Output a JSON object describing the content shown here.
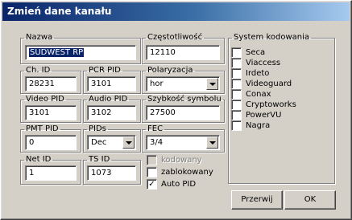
{
  "window": {
    "title": "Zmień dane kanału"
  },
  "fields": {
    "nazwa": {
      "label": "Nazwa",
      "value": "SUDWEST RP"
    },
    "czestotliwosc": {
      "label": "Częstotliwość",
      "value": "12110"
    },
    "ch_id": {
      "label": "Ch. ID",
      "value": "28231"
    },
    "pcr_pid": {
      "label": "PCR PID",
      "value": "3101"
    },
    "polaryzacja": {
      "label": "Polaryzacja",
      "value": "hor"
    },
    "video_pid": {
      "label": "Video PID",
      "value": "3101"
    },
    "audio_pid": {
      "label": "Audio PID",
      "value": "3102"
    },
    "szybkosc_symbolu": {
      "label": "Szybkość symbolu",
      "value": "27500"
    },
    "pmt_pid": {
      "label": "PMT PID",
      "value": "0"
    },
    "pids": {
      "label": "PIDs",
      "value": "Dec"
    },
    "fec": {
      "label": "FEC",
      "value": "3/4"
    },
    "net_id": {
      "label": "Net ID",
      "value": "1"
    },
    "ts_id": {
      "label": "TS ID",
      "value": "1073"
    }
  },
  "flags": [
    {
      "label": "kodowany",
      "checked": false,
      "disabled": true
    },
    {
      "label": "zablokowany",
      "checked": false,
      "disabled": false
    },
    {
      "label": "Auto PID",
      "checked": true,
      "disabled": false
    }
  ],
  "encoding": {
    "label": "System kodowania",
    "systems": [
      "Seca",
      "Viaccess",
      "Irdeto",
      "Videoguard",
      "Conax",
      "Cryptoworks",
      "PowerVU",
      "Nagra"
    ]
  },
  "buttons": {
    "cancel": "Przerwij",
    "ok": "OK"
  }
}
